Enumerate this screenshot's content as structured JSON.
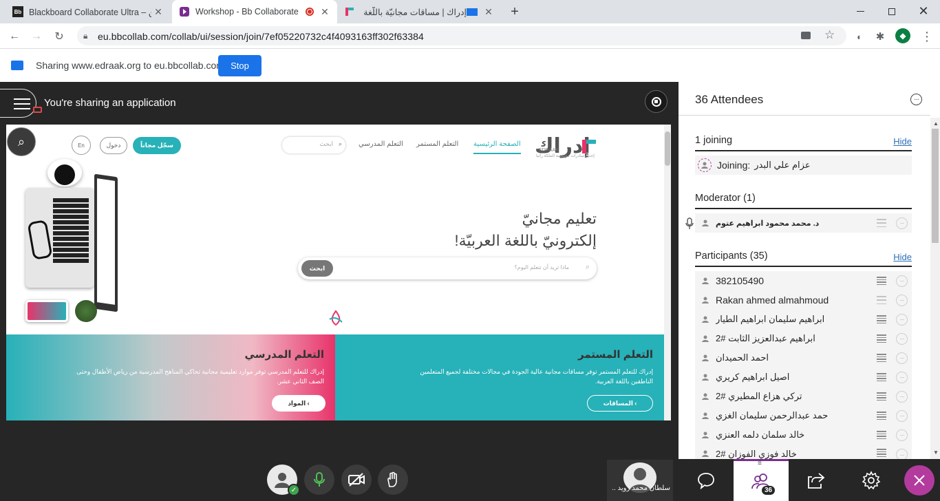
{
  "browser": {
    "tabs": [
      {
        "title": "Blackboard Collaborate Ultra – ين",
        "favicon": "Bb",
        "active": false
      },
      {
        "title": "Workshop - Bb Collaborate",
        "favicon": "collaborate-logo",
        "active": true,
        "recording": true
      },
      {
        "title": "إدراك | مساقات مجانيّة باللّغة ال",
        "favicon": "edraak-logo",
        "active": false
      }
    ],
    "new_tab": "+",
    "url": "eu.bbcollab.com/collab/ui/session/join/7ef05220732c4f4093163ff302f63384",
    "profile_initial": "◆"
  },
  "share_bar": {
    "message": "Sharing www.edraak.org to eu.bbcollab.com",
    "stop_label": "Stop"
  },
  "stage": {
    "sharing_label": "You're sharing an application"
  },
  "shared_page": {
    "logo_text": "إدراك",
    "logo_sub": "EDRAAK",
    "logo_tagline": "إحدى مبادرات مؤسسة الملكة رانيا",
    "nav": [
      "الصفحة الرئيسية",
      "التعلم المستمر",
      "التعلم المدرسي"
    ],
    "search_placeholder": "ابحث",
    "signup": "سجّل مجاناً",
    "login": "دخول",
    "lang": "En",
    "hero_line1": "تعليم مجانيّ",
    "hero_line2": "إلكترونيّ باللغة العربيّة!",
    "hero_search_placeholder": "ماذا تريد أن تتعلم اليوم؟",
    "hero_search_button": "ابحث",
    "card1_title": "التعلم المدرسي",
    "card1_text": "إدراك للتعلم المدرسي توفر موارد تعليمية مجانية تحاكي المناهج المدرسية من رياض الأطفال وحتى الصف الثاني عشر.",
    "card1_button": "المواد",
    "card2_title": "التعلم المستمر",
    "card2_text": "إدراك للتعلم المستمر توفر مساقات مجانية عالية الجودة في مجالات مختلفة لجميع المتعلمين الناطقين باللغة العربية.",
    "card2_button": "المساقات"
  },
  "video_tile": {
    "name": "سلطان محمد زويد ..."
  },
  "panel": {
    "title": "36 Attendees",
    "joining_header": "1 joining",
    "hide_label": "Hide",
    "joining_prefix": "Joining:",
    "joining_name": "عزام علي البدر",
    "moderator_header": "Moderator (1)",
    "moderator_name": "د. محمد محمود ابراهيم عتوم",
    "participants_header": "Participants (35)",
    "participants": [
      "382105490",
      "Rakan ahmed almahmoud",
      "ابراهيم سليمان ابراهيم الطيار",
      "ابراهيم عبدالعزيز الثابت #2",
      "احمد الحميدان",
      "اصيل ابراهيم كريري",
      "تركي هزاع المطيري #2",
      "حمد عبدالرحمن سليمان الغزي",
      "خالد سلمان دلمه العنزي",
      "خالد فوزي الفوزان #2"
    ],
    "attendee_badge": "36"
  },
  "colors": {
    "teal": "#27b1b8",
    "stop_blue": "#1a73e8",
    "close_purple": "#b33b9e",
    "link_blue": "#2d6fb6",
    "tab_purple": "#7a2d8f"
  }
}
